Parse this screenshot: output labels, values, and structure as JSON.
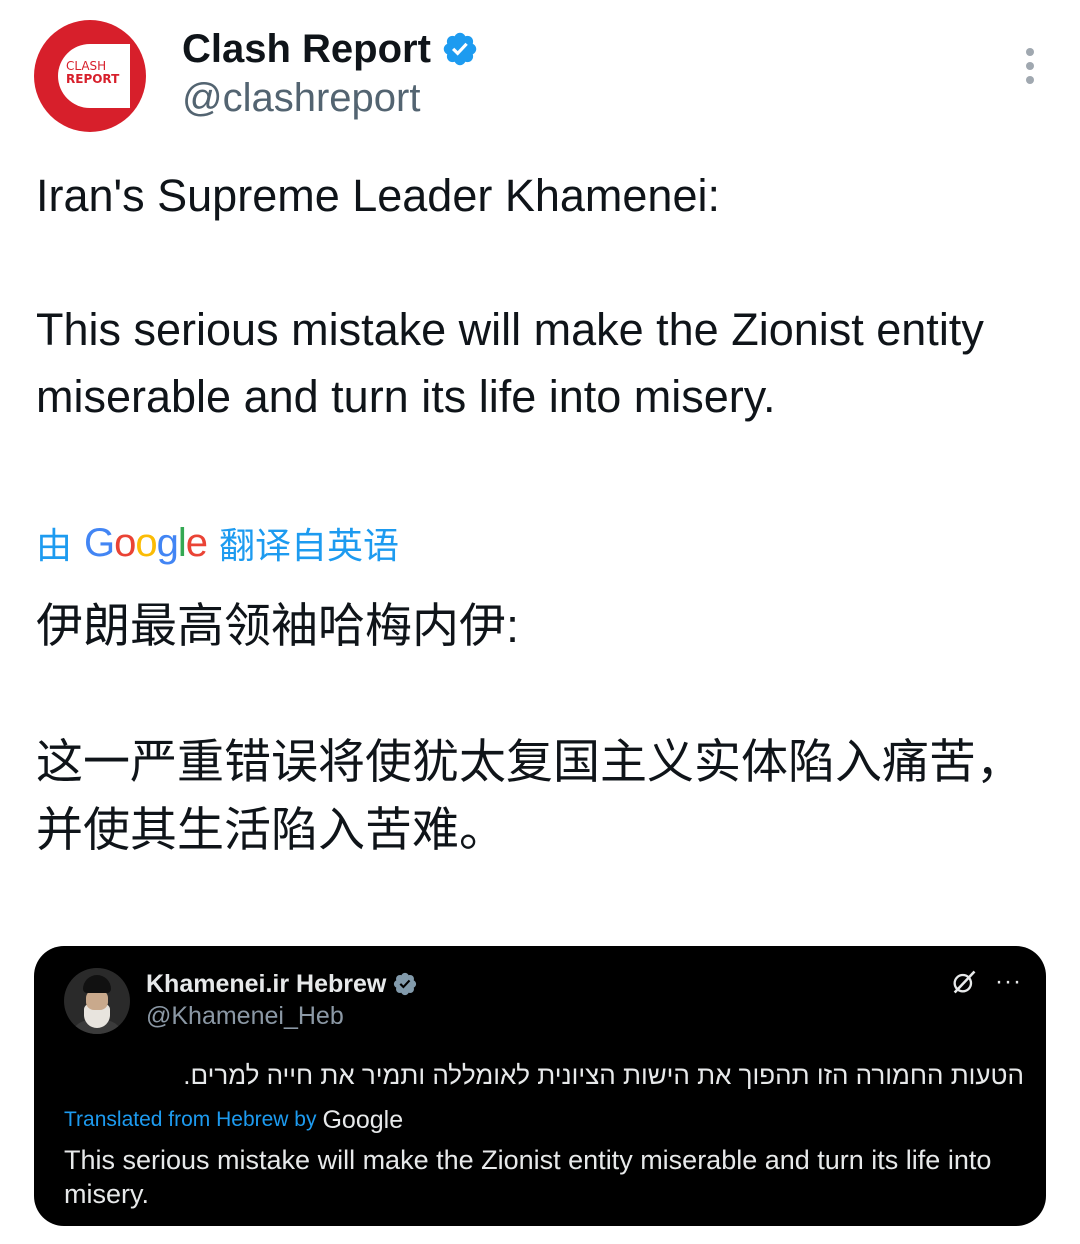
{
  "author": {
    "avatar_text_line1": "CLASH",
    "avatar_text_line2": "REPORT",
    "display_name": "Clash Report",
    "handle": "@clashreport",
    "verified": true,
    "brand_color": "#d71f2b"
  },
  "tweet": {
    "text": "Iran's Supreme Leader Khamenei:\n\nThis serious mistake will make the Zionist entity miserable and turn its life into misery.",
    "translate_prefix": "由",
    "translate_brand": "Google",
    "translate_suffix": "翻译自英语",
    "translated_text": "伊朗最高领袖哈梅内伊:\n\n这一严重错误将使犹太复国主义实体陷入痛苦，并使其生活陷入苦难。"
  },
  "quoted": {
    "display_name": "Khamenei.ir Hebrew",
    "handle": "@Khamenei_Heb",
    "verified": true,
    "original_text": "הטעות החמורה הזו תהפוך את הישות הציונית לאומללה ותמיר את חייה למרים.",
    "translated_label": "Translated from Hebrew by",
    "translated_brand": "Google",
    "translated_text": "This serious mistake will make the Zionist entity miserable and turn its life into misery.",
    "more_glyph": "···"
  },
  "icons": {
    "verified": "verified-badge-icon",
    "more": "more-vertical-icon",
    "grok": "grok-icon",
    "quoted_more": "more-horizontal-icon"
  },
  "colors": {
    "link_blue": "#1d9bf0",
    "text_primary": "#0f1419",
    "text_secondary": "#536471"
  }
}
